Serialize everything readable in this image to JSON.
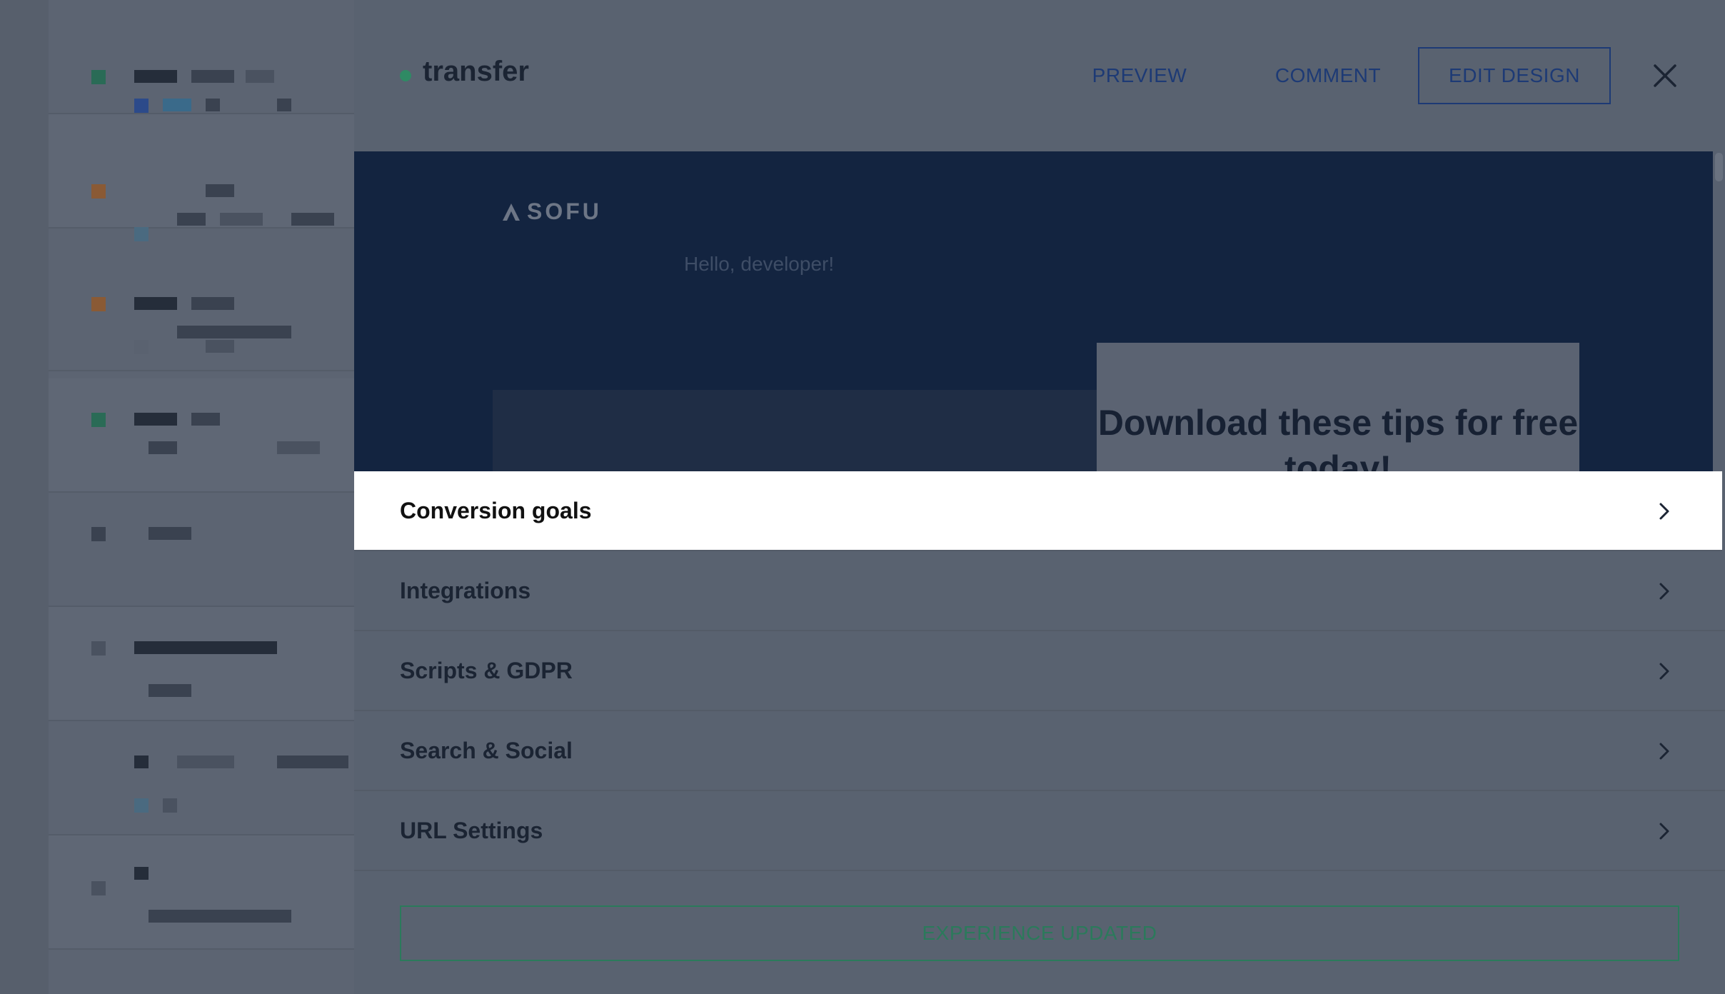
{
  "drawer": {
    "title": "transfer",
    "status_color": "#2f8a64",
    "actions": {
      "preview": "PREVIEW",
      "comment": "COMMENT",
      "edit_design": "EDIT DESIGN",
      "close_icon": "close-icon"
    }
  },
  "preview": {
    "logo": "SOFU",
    "greeting": "Hello, developer!",
    "card_heading": "Download these tips for free today!"
  },
  "settings": {
    "items": [
      {
        "label": "Conversion goals",
        "active": true
      },
      {
        "label": "Integrations",
        "active": false
      },
      {
        "label": "Scripts & GDPR",
        "active": false
      },
      {
        "label": "Search & Social",
        "active": false
      },
      {
        "label": "URL Settings",
        "active": false
      }
    ]
  },
  "footer": {
    "status_button": "EXPERIENCE UPDATED"
  },
  "colors": {
    "accent_blue": "#1d3a75",
    "success_green": "#2b7a5b",
    "preview_bg": "#132440"
  }
}
